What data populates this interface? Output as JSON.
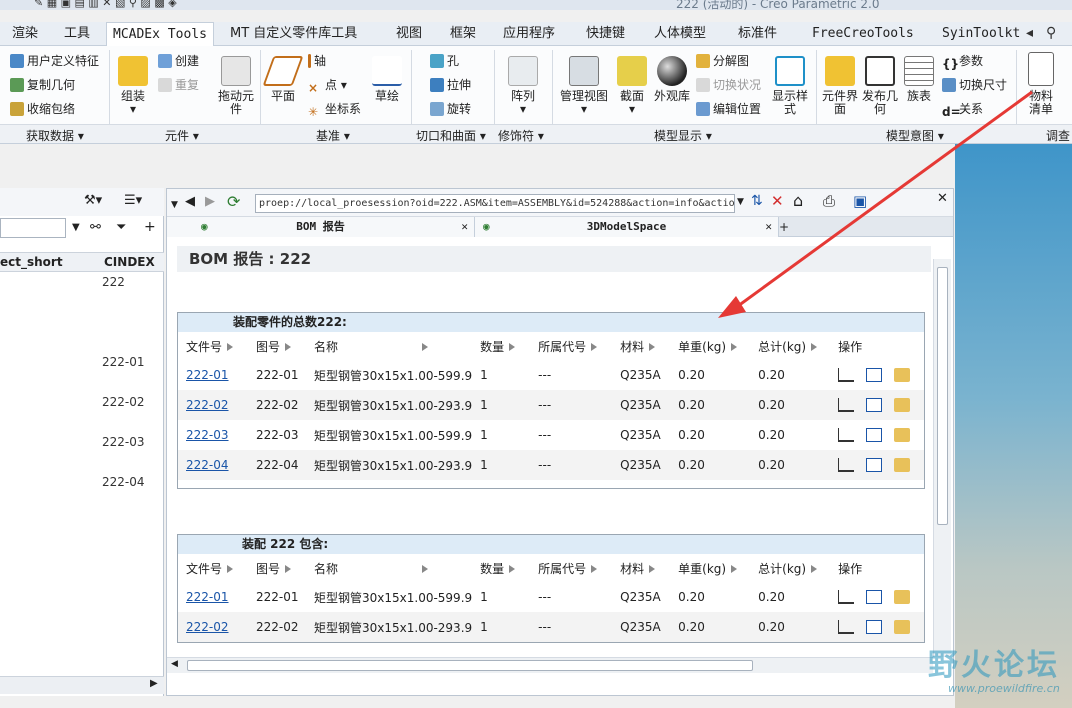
{
  "window": {
    "title": "222 (活动的) - Creo Parametric 2.0"
  },
  "tabs": [
    {
      "label": "渲染"
    },
    {
      "label": "工具"
    },
    {
      "label": "MCADEx Tools"
    },
    {
      "label": "MT 自定义零件库工具"
    },
    {
      "label": "视图"
    },
    {
      "label": "框架"
    },
    {
      "label": "应用程序"
    },
    {
      "label": "快捷键"
    },
    {
      "label": "人体模型"
    },
    {
      "label": "标准件"
    },
    {
      "label": "FreeCreoTools"
    },
    {
      "label": "SyinToolkt"
    }
  ],
  "ribbon": {
    "get_data": [
      "用户定义特征",
      "复制几何",
      "收缩包络"
    ],
    "assemble": "组装",
    "create": "创建",
    "redo": "重复",
    "drag": "拖动元件",
    "plane": "平面",
    "axis": "轴",
    "point": "点",
    "csys": "坐标系",
    "sketch": "草绘",
    "hole": "孔",
    "extrude": "拉伸",
    "revolve": "旋转",
    "pattern": "阵列",
    "manage_views": "管理视图",
    "section": "截面",
    "appearance": "外观库",
    "explode": "分解图",
    "toggle_state": "切换状况",
    "edit_position": "编辑位置",
    "display_style": "显示样式",
    "comp_interface": "元件界面",
    "publish_geom": "发布几何",
    "family_table": "族表",
    "params": "参数",
    "switch_dims": "切换尺寸",
    "relations": "关系",
    "bom": "物料清单"
  },
  "groups": {
    "get_data": "获取数据",
    "component": "元件",
    "datum": "基准",
    "cut_surface": "切口和曲面",
    "modifier": "修饰符",
    "model_display": "模型显示",
    "model_intent": "模型意图",
    "investigate": "调查"
  },
  "left_panel": {
    "col1": "ect_short",
    "col2": "CINDEX",
    "rows": [
      "222",
      "222-01",
      "222-02",
      "222-03",
      "222-04"
    ]
  },
  "browser": {
    "url": "proep://local_proesession?oid=222.ASM&item=ASSEMBLY&id=524288&action=info&action=bom",
    "tab1": "BOM 报告",
    "tab2": "3DModelSpace",
    "page_title": "BOM 报告 : 222",
    "columns": [
      "文件号",
      "图号",
      "名称",
      "数量",
      "所属代号",
      "材料",
      "单重(kg)",
      "总计(kg)",
      "操作"
    ],
    "section1": {
      "caption": "装配零件的总数222:",
      "rows": [
        {
          "file": "222-01",
          "drawing": "222-01",
          "name": "矩型钢管30x15x1.00-599.9",
          "qty": "1",
          "code": "---",
          "material": "Q235A",
          "unit": "0.20",
          "total": "0.20"
        },
        {
          "file": "222-02",
          "drawing": "222-02",
          "name": "矩型钢管30x15x1.00-293.9",
          "qty": "1",
          "code": "---",
          "material": "Q235A",
          "unit": "0.20",
          "total": "0.20"
        },
        {
          "file": "222-03",
          "drawing": "222-03",
          "name": "矩型钢管30x15x1.00-599.9",
          "qty": "1",
          "code": "---",
          "material": "Q235A",
          "unit": "0.20",
          "total": "0.20"
        },
        {
          "file": "222-04",
          "drawing": "222-04",
          "name": "矩型钢管30x15x1.00-293.9",
          "qty": "1",
          "code": "---",
          "material": "Q235A",
          "unit": "0.20",
          "total": "0.20"
        }
      ]
    },
    "section2": {
      "caption": "装配 222 包含:",
      "rows": [
        {
          "file": "222-01",
          "drawing": "222-01",
          "name": "矩型钢管30x15x1.00-599.9",
          "qty": "1",
          "code": "---",
          "material": "Q235A",
          "unit": "0.20",
          "total": "0.20"
        },
        {
          "file": "222-02",
          "drawing": "222-02",
          "name": "矩型钢管30x15x1.00-293.9",
          "qty": "1",
          "code": "---",
          "material": "Q235A",
          "unit": "0.20",
          "total": "0.20"
        }
      ]
    }
  },
  "watermark": {
    "cn": "野火论坛",
    "url": "www.proewildfire.cn"
  },
  "colors": {
    "accent": "#1a55a8",
    "arrow": "#e53935",
    "caption_bg": "#ddebf7"
  }
}
